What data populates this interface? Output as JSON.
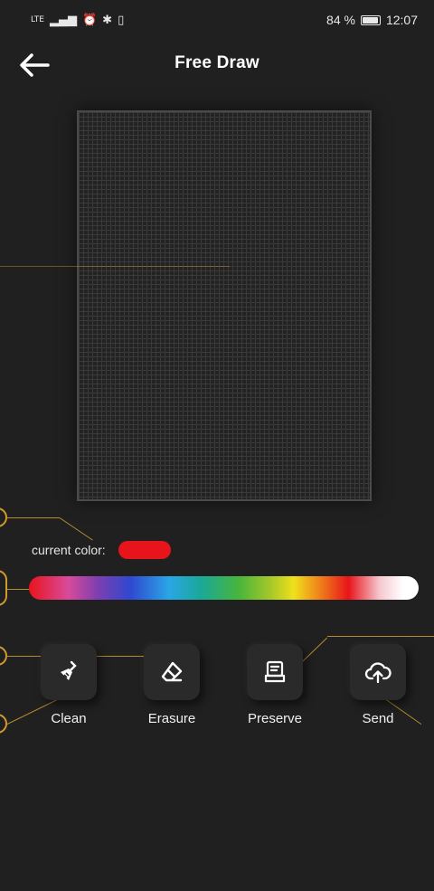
{
  "status_bar": {
    "signal": "LTE",
    "battery_percent": "84 %",
    "time": "12:07"
  },
  "header": {
    "back_icon": "arrow-left-icon",
    "title": "Free Draw"
  },
  "canvas": {
    "grid_color": "#3a3a3a",
    "background": "#232323"
  },
  "current_color": {
    "label": "current color:",
    "value": "#e8141b"
  },
  "tools": [
    {
      "label": "Clean",
      "icon": "broom-icon"
    },
    {
      "label": "Erasure",
      "icon": "eraser-icon"
    },
    {
      "label": "Preserve",
      "icon": "save-document-icon"
    },
    {
      "label": "Send",
      "icon": "cloud-upload-icon"
    }
  ],
  "colors": {
    "background": "#202020",
    "accent_line": "#b88a2e"
  }
}
